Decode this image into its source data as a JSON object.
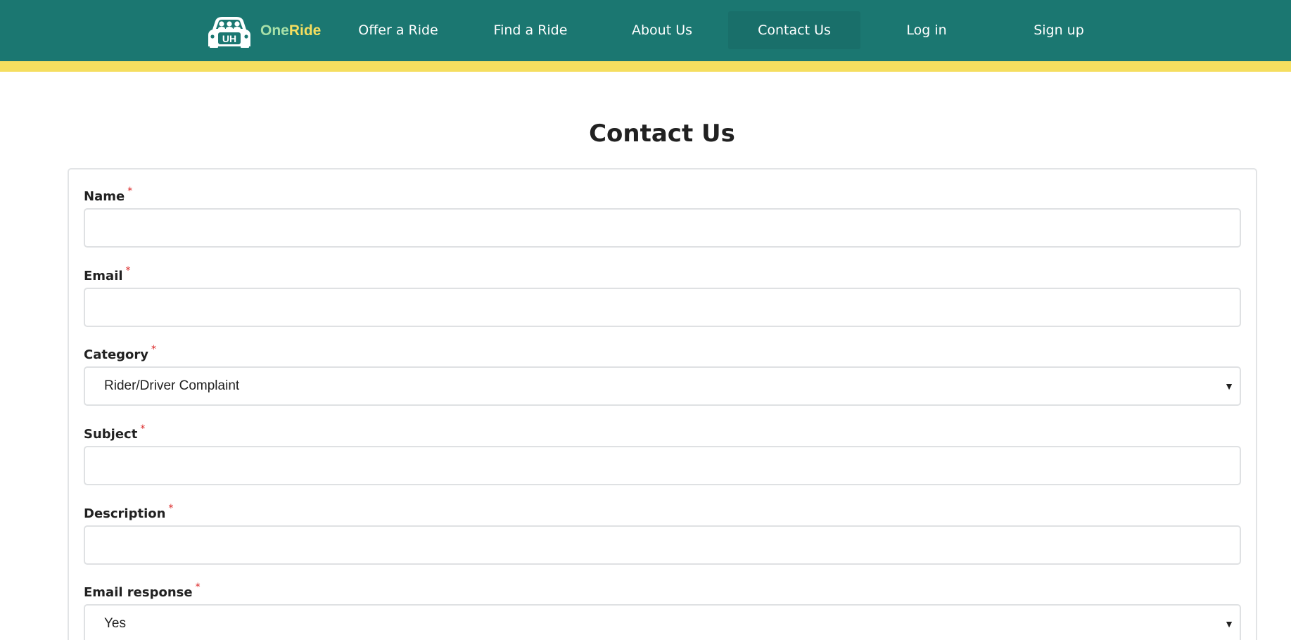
{
  "brand": {
    "logo_letters": "UH",
    "name_part1": "One",
    "name_part2": "Ride",
    "colors": {
      "header": "#1b7771",
      "stripe": "#f5de5f",
      "name_one": "#a7e0a8",
      "name_ride": "#f5de5f"
    }
  },
  "nav": {
    "items": [
      {
        "label": "Offer a Ride"
      },
      {
        "label": "Find a Ride"
      },
      {
        "label": "About Us"
      },
      {
        "label": "Contact Us",
        "active": true
      },
      {
        "label": "Log in"
      },
      {
        "label": "Sign up"
      }
    ]
  },
  "page": {
    "title": "Contact Us"
  },
  "form": {
    "required_marker": "*",
    "fields": {
      "name": {
        "label": "Name",
        "value": ""
      },
      "email": {
        "label": "Email",
        "value": ""
      },
      "category": {
        "label": "Category",
        "selected": "Rider/Driver Complaint"
      },
      "subject": {
        "label": "Subject",
        "value": ""
      },
      "description": {
        "label": "Description",
        "value": ""
      },
      "email_response": {
        "label": "Email response",
        "selected": "Yes"
      }
    }
  },
  "icons": {
    "logo": "car-logo-icon",
    "dropdown": "chevron-down-icon"
  }
}
